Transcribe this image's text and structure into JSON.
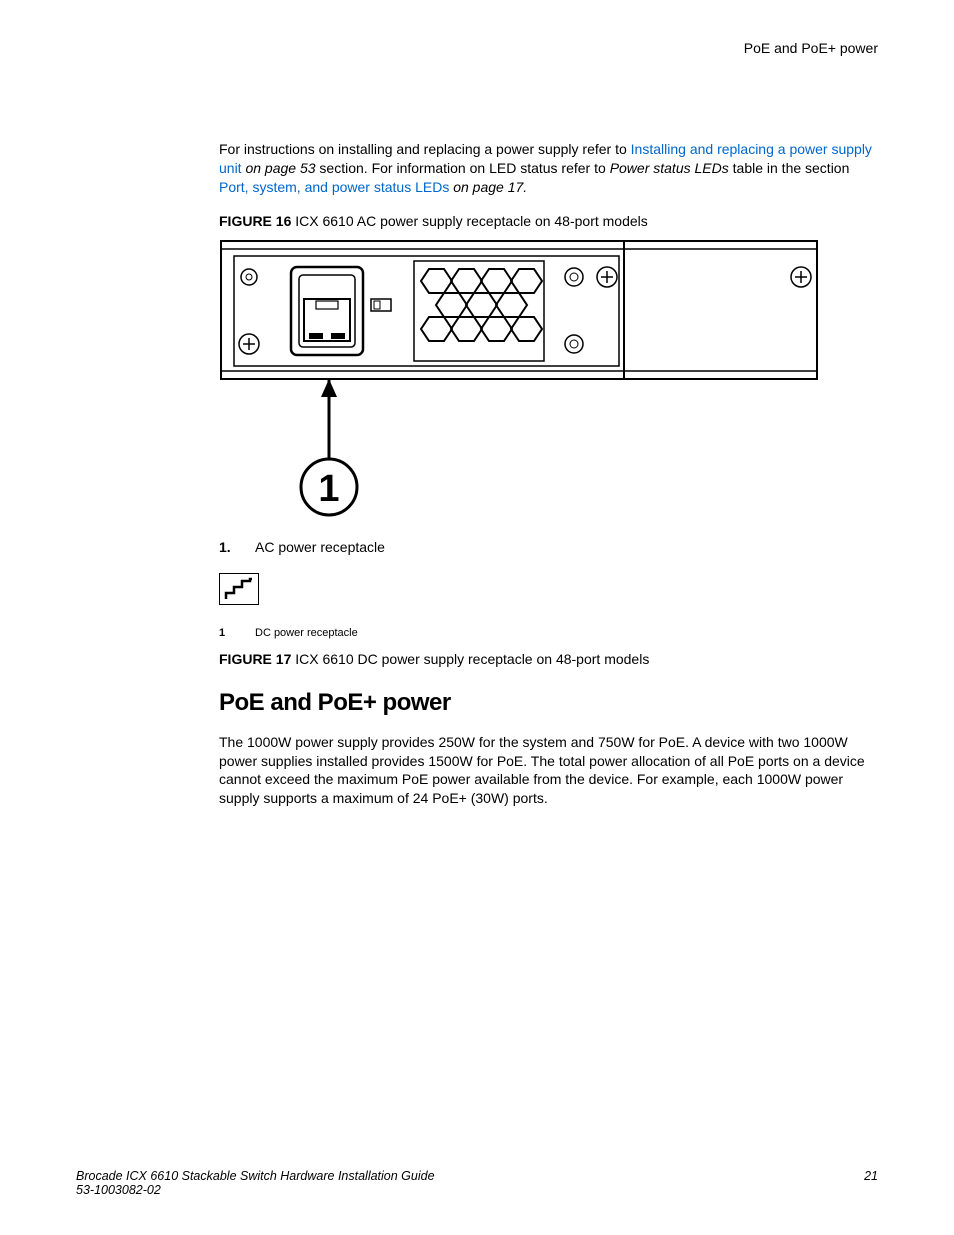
{
  "header": {
    "right_text": "PoE and PoE+ power"
  },
  "intro": {
    "text_before_link1": "For instructions on installing and replacing a power supply refer to ",
    "link1": "Installing and replacing a power supply unit",
    "text_after_link1": " on page 53",
    "text_mid": " section. For information on LED status refer to ",
    "italic_ref": "Power status LEDs",
    "text_after_ref": " table in the section ",
    "link2": "Port, system, and power status LEDs",
    "text_after_link2": " on page 17."
  },
  "figure16": {
    "label": "FIGURE 16 ",
    "caption": "ICX 6610 AC power supply receptacle on 48-port models",
    "callout_marker": "1",
    "callout_items": [
      {
        "num": "1.",
        "text": "AC power receptacle"
      }
    ]
  },
  "legend_fig17": {
    "items": [
      {
        "num": "1",
        "text": "DC power receptacle"
      }
    ]
  },
  "figure17": {
    "label": "FIGURE 17 ",
    "caption": "ICX 6610 DC power supply receptacle on 48-port models"
  },
  "section": {
    "heading": "PoE and PoE+ power",
    "body": "The 1000W power supply provides 250W for the system and 750W for PoE. A device with two 1000W power supplies installed provides 1500W for PoE. The total power allocation of all PoE ports on a device cannot exceed the maximum PoE power available from the device. For example, each 1000W power supply supports a maximum of 24 PoE+ (30W) ports."
  },
  "footer": {
    "title": "Brocade ICX 6610 Stackable Switch Hardware Installation Guide",
    "docnum": "53-1003082-02",
    "page": "21"
  }
}
